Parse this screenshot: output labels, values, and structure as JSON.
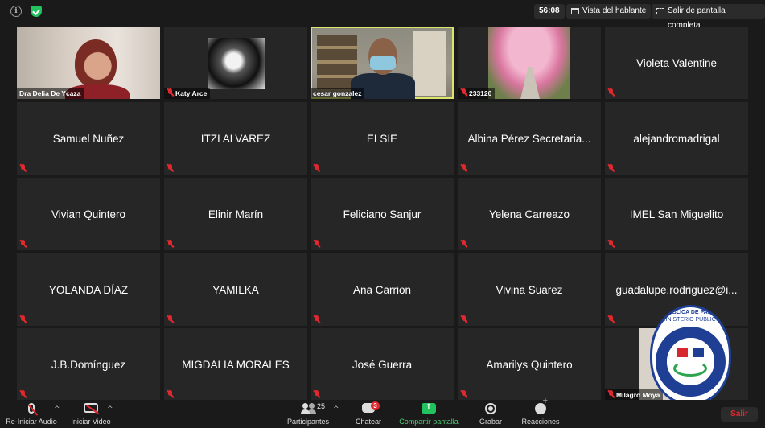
{
  "topbar": {
    "timer": "56:08",
    "speaker_view": "Vista del hablante",
    "exit_fullscreen": "Salir de pantalla completa"
  },
  "participants": [
    {
      "name": "Dra Delia De Ycaza",
      "video": true
    },
    {
      "name": "Katy Arce",
      "video": true
    },
    {
      "name": "cesar gonzalez",
      "video": true,
      "active_speaker": true
    },
    {
      "name": "233120",
      "video": true
    },
    {
      "name": "Violeta Valentine",
      "video": false
    },
    {
      "name": "Samuel Nuñez",
      "video": false
    },
    {
      "name": "ITZI ALVAREZ",
      "video": false
    },
    {
      "name": "ELSIE",
      "video": false
    },
    {
      "name": "Albina Pérez  Secretaria...",
      "video": false
    },
    {
      "name": "alejandromadrigal",
      "video": false
    },
    {
      "name": "Vivian Quintero",
      "video": false
    },
    {
      "name": "Elinir Marín",
      "video": false
    },
    {
      "name": "Feliciano Sanjur",
      "video": false
    },
    {
      "name": "Yelena Carreazo",
      "video": false
    },
    {
      "name": "IMEL San Miguelito",
      "video": false
    },
    {
      "name": "YOLANDA DÍAZ",
      "video": false
    },
    {
      "name": "YAMILKA",
      "video": false
    },
    {
      "name": "Ana Carrion",
      "video": false
    },
    {
      "name": "Vivina Suarez",
      "video": false
    },
    {
      "name": "guadalupe.rodriguez@i...",
      "video": false
    },
    {
      "name": "J.B.Domínguez",
      "video": false
    },
    {
      "name": "MIGDALIA MORALES",
      "video": false
    },
    {
      "name": "José Guerra",
      "video": false
    },
    {
      "name": "Amarilys Quintero",
      "video": false
    },
    {
      "name": "Milagro Moya",
      "video": true
    }
  ],
  "logo": {
    "line1": "REPÚBLICA DE PANAMÁ",
    "line2": "MINISTERIO PÚBLICO",
    "ring_text": "INSTITUTO DE MEDICINA LEGAL Y CIENCIAS FORENSES"
  },
  "toolbar": {
    "audio": "Re-Iniciar Audio",
    "video": "Iniciar Video",
    "participants": "Participantes",
    "participant_count": "25",
    "chat": "Chatear",
    "chat_badge": "3",
    "share": "Compartir pantalla",
    "record": "Grabar",
    "reactions": "Reacciones",
    "leave": "Salir"
  },
  "colors": {
    "active_speaker_border": "#d9e56c",
    "muted": "#e0282e",
    "share": "#22c35e",
    "leave_text": "#e0282e"
  }
}
